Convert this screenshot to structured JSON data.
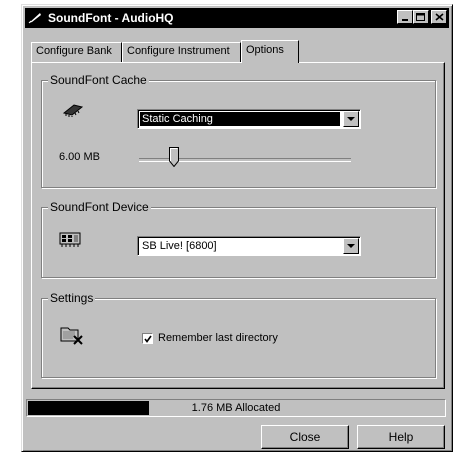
{
  "window": {
    "title": "SoundFont - AudioHQ"
  },
  "tabs": [
    {
      "label": "Configure Bank"
    },
    {
      "label": "Configure Instrument"
    },
    {
      "label": "Options",
      "active": true
    }
  ],
  "cache_group": {
    "label": "SoundFont Cache",
    "caching_mode": "Static Caching",
    "size_label": "6.00 MB",
    "size_slider_fraction": 0.16,
    "icon": "memory-chip-icon"
  },
  "device_group": {
    "label": "SoundFont Device",
    "device": "SB Live! [6800]",
    "icon": "sound-card-icon"
  },
  "settings_group": {
    "label": "Settings",
    "remember_dir_label": "Remember last directory",
    "remember_dir_checked": true,
    "icon": "folder-settings-icon"
  },
  "status": {
    "allocated_text": "1.76 MB Allocated",
    "progress_fraction": 0.29
  },
  "buttons": {
    "close": "Close",
    "help": "Help"
  }
}
